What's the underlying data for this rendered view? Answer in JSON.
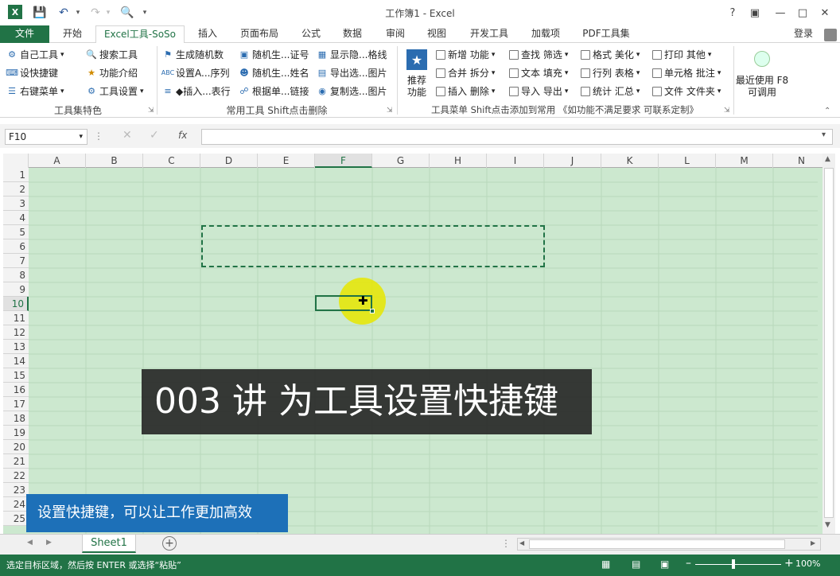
{
  "app": {
    "title": "工作簿1 - Excel",
    "login": "登录"
  },
  "tabs": [
    "文件",
    "开始",
    "Excel工具-SoSo",
    "插入",
    "页面布局",
    "公式",
    "数据",
    "审阅",
    "视图",
    "开发工具",
    "加载项",
    "PDF工具集"
  ],
  "ribbon": {
    "group1": {
      "items": [
        "自己工具",
        "设快捷键",
        "右键菜单",
        "搜索工具",
        "功能介绍",
        "工具设置"
      ],
      "label": "工具集特色"
    },
    "group2": {
      "items": [
        "生成随机数",
        "随机生...证号",
        "显示隐...格线",
        "设置A...序列",
        "随机生...姓名",
        "导出选...图片",
        "◆插入...表行",
        "根据单...链接",
        "复制选...图片"
      ],
      "label": "常用工具 Shift点击删除"
    },
    "group3": {
      "recommend": "推荐\n功能",
      "items": [
        "新增 功能",
        "查找 筛选",
        "格式 美化",
        "打印 其他",
        "合并 拆分",
        "文本 填充",
        "行列 表格",
        "单元格 批注",
        "插入 删除",
        "导入 导出",
        "统计 汇总",
        "文件 文件夹"
      ],
      "label": "工具菜单 Shift点击添加到常用 《如功能不满足要求 可联系定制》"
    },
    "group4": {
      "label": "最近使用 F8\n可调用"
    }
  },
  "formula_bar": {
    "name_box": "F10",
    "value": ""
  },
  "columns": [
    "A",
    "B",
    "C",
    "D",
    "E",
    "F",
    "G",
    "H",
    "I",
    "J",
    "K",
    "L",
    "M",
    "N"
  ],
  "selected_column": "F",
  "rows": [
    "1",
    "2",
    "3",
    "4",
    "5",
    "6",
    "7",
    "8",
    "9",
    "10",
    "11",
    "12",
    "13",
    "14",
    "15",
    "16",
    "17",
    "18",
    "19",
    "20",
    "21",
    "22",
    "23",
    "24",
    "25"
  ],
  "selected_row": "10",
  "sheet_tab": "Sheet1",
  "status": {
    "message": "选定目标区域，然后按 ENTER 或选择“粘贴”",
    "zoom": "100%"
  },
  "captions": {
    "big": "003 讲 为工具设置快捷键",
    "small": "设置快捷键，可以让工作更加高效"
  },
  "colors": {
    "excel_green": "#217346",
    "grid_bg": "#cce8cf",
    "caption_blue": "#1d70b8"
  }
}
